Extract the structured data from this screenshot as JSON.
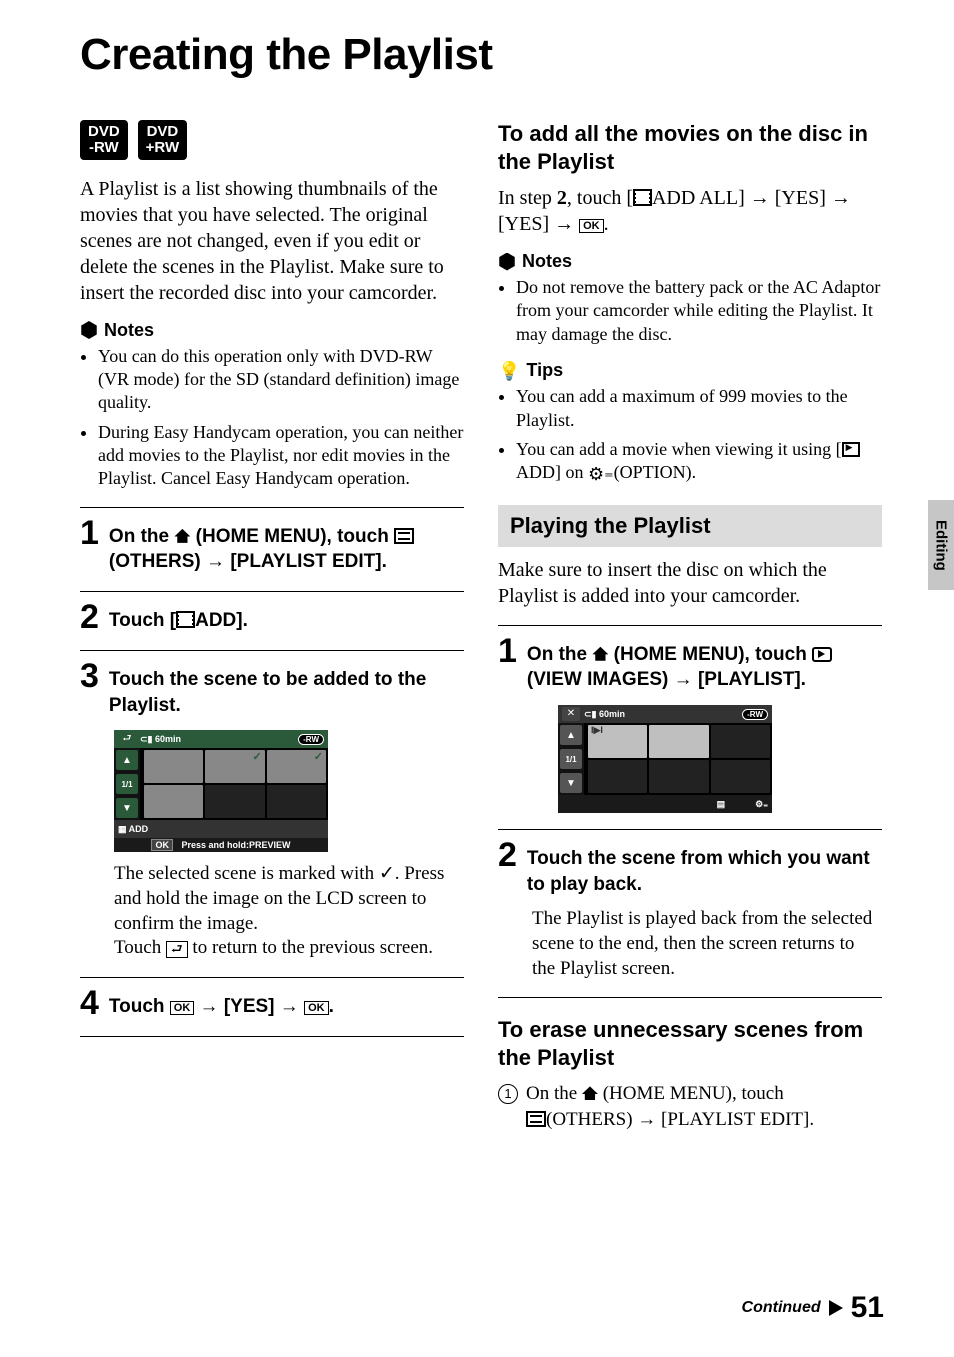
{
  "title": "Creating the Playlist",
  "side_tab": "Editing",
  "badges": {
    "a": "DVD\n-RW",
    "b": "DVD\n+RW"
  },
  "intro": "A Playlist is a list showing thumbnails of the movies that you have selected. The original scenes are not changed, even if you edit or delete the scenes in the Playlist. Make sure to insert the recorded disc into your camcorder.",
  "notes_label": "Notes",
  "tips_label": "Tips",
  "left_notes": [
    "You can do this operation only with DVD-RW (VR mode) for the SD (standard definition) image quality.",
    "During Easy Handycam operation, you can neither add movies to the Playlist, nor edit movies in the Playlist. Cancel Easy Handycam operation."
  ],
  "steps": {
    "s1": {
      "pre": "On the ",
      "home": " (HOME MENU), touch ",
      "others": "(OTHERS)",
      "arrow": " → ",
      "tail": "[PLAYLIST EDIT]."
    },
    "s2": {
      "pre": "Touch [",
      "tail": "ADD]."
    },
    "s3": {
      "text": "Touch the scene to be added to the Playlist.",
      "after_a": "The selected scene is marked with ",
      "after_b": ". Press and hold the image on the LCD screen to confirm the image.",
      "after_c": "Touch ",
      "after_d": " to return to the previous screen."
    },
    "s4": {
      "pre": "Touch ",
      "mid1": " → [YES] → ",
      "tail": "."
    }
  },
  "screen1": {
    "time": "60min",
    "page": "1/1",
    "add": "ADD",
    "hint": "Press and hold:PREVIEW",
    "ok": "OK",
    "rw": "-RW"
  },
  "right": {
    "h_addall": "To add all the movies on the disc in the Playlist",
    "addall_a": "In step ",
    "addall_b": "2",
    "addall_c": ", touch [",
    "addall_d": "ADD ALL] → [YES] → [YES] → ",
    "addall_e": ".",
    "notes": [
      "Do not remove the battery pack or the AC Adaptor from your camcorder while editing the Playlist. It may damage the disc."
    ],
    "tips": [
      "You can add a maximum of 999 movies to the Playlist.",
      {
        "a": "You can add a movie when viewing it using [",
        "b": "ADD] on ",
        "c": "(OPTION)."
      }
    ],
    "playing_h": "Playing the Playlist",
    "playing_intro": "Make sure to insert the disc on which the Playlist is added into your camcorder.",
    "pstep1": {
      "pre": "On the ",
      "home": " (HOME MENU), touch ",
      "view": "(VIEW IMAGES)",
      "arrow": " → ",
      "tail": "[PLAYLIST]."
    },
    "pstep2": {
      "text": "Touch the scene from which you want to play back.",
      "body": "The Playlist is played back from the selected scene to the end, then the screen returns to the Playlist screen."
    },
    "erase_h": "To erase unnecessary scenes from the Playlist",
    "erase1_a": "On the ",
    "erase1_b": " (HOME MENU), touch ",
    "erase1_c": "(OTHERS) → [PLAYLIST EDIT]."
  },
  "screen2": {
    "time": "60min",
    "page": "1/1",
    "rw": "-RW"
  },
  "footer": {
    "continued": "Continued",
    "page": "51"
  },
  "ok_label": "OK"
}
